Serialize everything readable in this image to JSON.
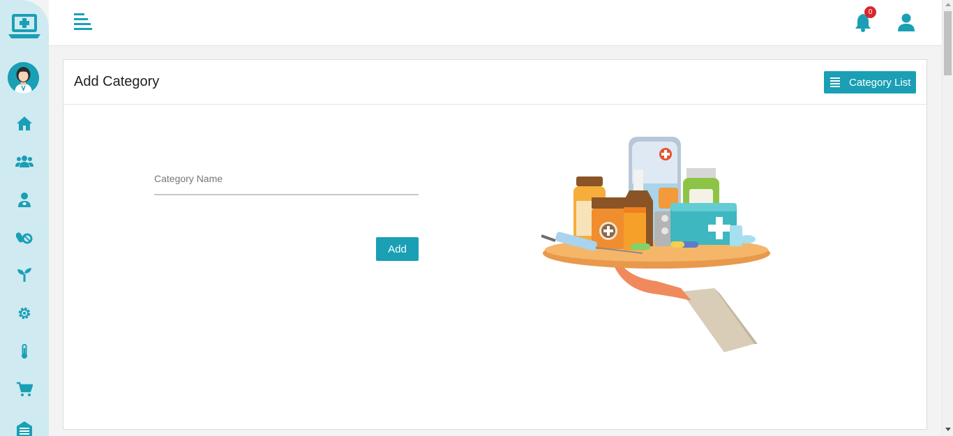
{
  "app": {
    "brand_icon": "medical-laptop-icon",
    "avatar": "doctor-avatar"
  },
  "sidebar": {
    "items": [
      {
        "icon": "home-icon"
      },
      {
        "icon": "users-icon"
      },
      {
        "icon": "doctor-icon"
      },
      {
        "icon": "pills-icon"
      },
      {
        "icon": "sprout-icon"
      },
      {
        "icon": "gear-icon"
      },
      {
        "icon": "thermometer-icon"
      },
      {
        "icon": "cart-icon"
      },
      {
        "icon": "warehouse-icon"
      }
    ]
  },
  "topbar": {
    "notification_count": "0"
  },
  "page": {
    "title": "Add Category",
    "list_button_label": "Category List"
  },
  "form": {
    "category_name_placeholder": "Category Name",
    "category_name_value": "",
    "add_button_label": "Add"
  },
  "colors": {
    "accent": "#1a9fb5",
    "sidebar_bg": "#cfeaf1",
    "badge": "#d9262e"
  }
}
